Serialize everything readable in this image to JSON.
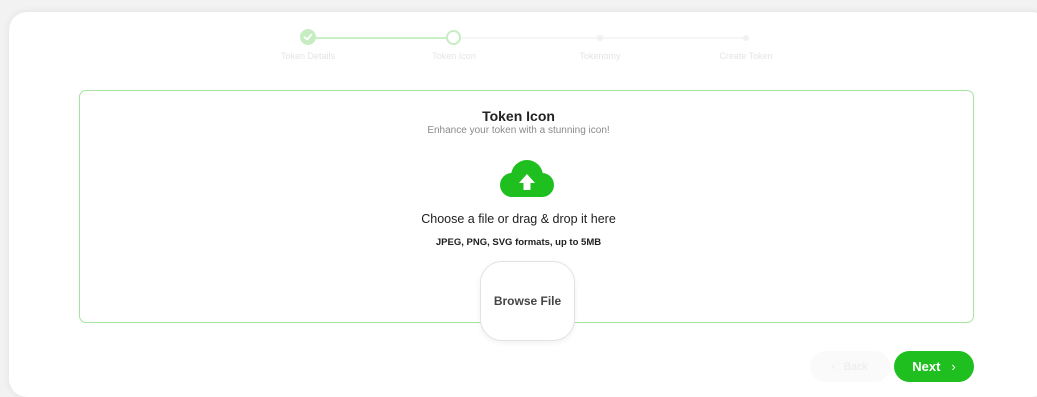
{
  "stepper": {
    "steps": [
      {
        "label": "Token Details",
        "status": "completed"
      },
      {
        "label": "Token Icon",
        "status": "active"
      },
      {
        "label": "Tokenomy",
        "status": "pending"
      },
      {
        "label": "Create Token",
        "status": "pending"
      }
    ]
  },
  "upload": {
    "title": "Token Icon",
    "subtitle": "Enhance your token with a stunning icon!",
    "choose_text": "Choose a file or drag & drop it here",
    "formats_text": "JPEG, PNG, SVG formats, up to 5MB",
    "browse_label": "Browse File",
    "icon": "cloud-upload-icon"
  },
  "nav": {
    "back_label": "Back",
    "next_label": "Next",
    "back_icon": "chevron-left-icon",
    "next_icon": "chevron-right-icon"
  },
  "colors": {
    "accent": "#1fbf1f",
    "border_light_green": "#a6e3a0",
    "stepper_faded": "#c8eec4"
  }
}
